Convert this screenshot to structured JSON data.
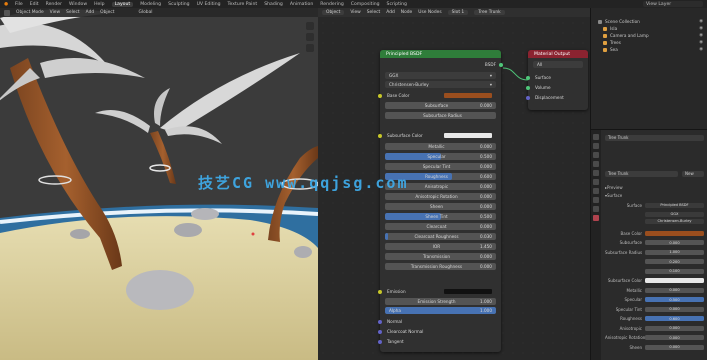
{
  "topbar": {
    "menus": [
      "File",
      "Edit",
      "Render",
      "Window",
      "Help"
    ],
    "workspaces": [
      "Layout",
      "Modeling",
      "Sculpting",
      "UV Editing",
      "Texture Paint",
      "Shading",
      "Animation",
      "Rendering",
      "Compositing",
      "Scripting"
    ],
    "active_workspace": "Layout",
    "view_layer": "View Layer"
  },
  "viewport": {
    "mode": "Object Mode",
    "menus": [
      "View",
      "Select",
      "Add",
      "Object"
    ],
    "transform": "Global"
  },
  "node_editor": {
    "type": "Object",
    "menus": [
      "View",
      "Select",
      "Add",
      "Node"
    ],
    "use_nodes_label": "Use Nodes",
    "slot": "Slot 1",
    "material": "Tree Trunk"
  },
  "bsdf_node": {
    "title": "Principled BSDF",
    "output_label": "BSDF",
    "distribution": "GGX",
    "subsurface_method": "Christensen-Burley",
    "base_color_label": "Base Color",
    "base_color": "#9a4e1e",
    "subsurface_color": "#e8e8e8",
    "emission_color": "#111111",
    "rows": [
      {
        "label": "Subsurface",
        "value": "0.000",
        "fill": 0
      },
      {
        "label": "Subsurface Radius",
        "value": "",
        "fill": 0
      },
      {
        "label": "Metallic",
        "value": "0.000",
        "fill": 0
      },
      {
        "label": "Specular",
        "value": "0.500",
        "fill": 0.5
      },
      {
        "label": "Specular Tint",
        "value": "0.000",
        "fill": 0
      },
      {
        "label": "Roughness",
        "value": "0.600",
        "fill": 0.6
      },
      {
        "label": "Anisotropic",
        "value": "0.000",
        "fill": 0
      },
      {
        "label": "Anisotropic Rotation",
        "value": "0.000",
        "fill": 0
      },
      {
        "label": "Sheen",
        "value": "0.000",
        "fill": 0
      },
      {
        "label": "Sheen Tint",
        "value": "0.500",
        "fill": 0.5
      },
      {
        "label": "Clearcoat",
        "value": "0.000",
        "fill": 0
      },
      {
        "label": "Clearcoat Roughness",
        "value": "0.030",
        "fill": 0.03
      },
      {
        "label": "IOR",
        "value": "1.450",
        "fill": 0
      },
      {
        "label": "Transmission",
        "value": "0.000",
        "fill": 0
      },
      {
        "label": "Transmission Roughness",
        "value": "0.000",
        "fill": 0
      }
    ],
    "subsurface_color_label": "Subsurface Color",
    "emission_label": "Emission",
    "emission_strength_label": "Emission Strength",
    "emission_strength": "1.000",
    "alpha_label": "Alpha",
    "alpha": "1.000",
    "alpha_fill": 1,
    "normal_label": "Normal",
    "clearcoat_normal_label": "Clearcoat Normal",
    "tangent_label": "Tangent"
  },
  "output_node": {
    "title": "Material Output",
    "target": "All",
    "sockets": [
      "Surface",
      "Volume",
      "Displacement"
    ]
  },
  "outliner": {
    "rows": [
      {
        "name": "Scene Collection",
        "color": "#8a8a8a"
      },
      {
        "name": "Isla",
        "color": "#e0a040"
      },
      {
        "name": "Camera and Lamp",
        "color": "#e0a040"
      },
      {
        "name": "Trees",
        "color": "#e0a040"
      },
      {
        "name": "Sea",
        "color": "#e0a040"
      }
    ]
  },
  "properties": {
    "slot_label": "Tree Trunk",
    "browse_name": "Tree Trunk",
    "new_label": "New",
    "preview_label": "Preview",
    "surface_label": "Surface",
    "surface_value": "Principled BSDF",
    "distribution": "GGX",
    "subsurface_method": "Christensen-Burley",
    "rows": [
      {
        "label": "Base Color",
        "value": "",
        "kind": "color"
      },
      {
        "label": "Subsurface",
        "value": "0.000",
        "kind": "num"
      },
      {
        "label": "Subsurface Radius",
        "value": "1.000",
        "kind": "num"
      },
      {
        "label": "",
        "value": "0.200",
        "kind": "num"
      },
      {
        "label": "",
        "value": "0.100",
        "kind": "num"
      },
      {
        "label": "Subsurface Color",
        "value": "",
        "kind": "white"
      },
      {
        "label": "Metallic",
        "value": "0.000",
        "kind": "num"
      },
      {
        "label": "Specular",
        "value": "0.500",
        "kind": "blue"
      },
      {
        "label": "Specular Tint",
        "value": "0.000",
        "kind": "num"
      },
      {
        "label": "Roughness",
        "value": "0.600",
        "kind": "blue"
      },
      {
        "label": "Anisotropic",
        "value": "0.000",
        "kind": "num"
      },
      {
        "label": "Anisotropic Rotation",
        "value": "0.000",
        "kind": "num"
      },
      {
        "label": "Sheen",
        "value": "0.000",
        "kind": "num"
      }
    ]
  },
  "watermark": "技艺CG  www.qqjsg.com"
}
